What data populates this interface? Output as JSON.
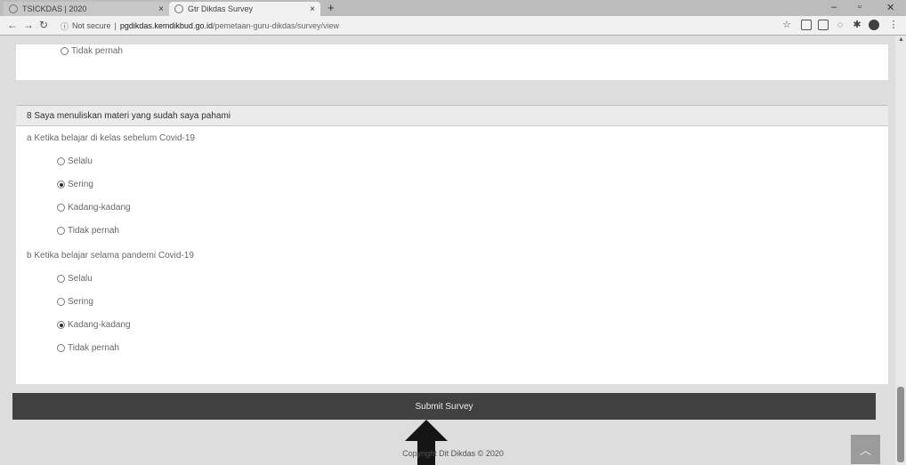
{
  "browser": {
    "tabs": [
      {
        "title": "TSICKDAS | 2020"
      },
      {
        "title": "Gtr Dikdas Survey"
      }
    ],
    "new_tab_label": "+",
    "close_label": "×",
    "url_security": "Not secure",
    "url_host": "pgdikdas.kemdikbud.go.id",
    "url_path": "/pemetaan-guru-dikdas/survey/view"
  },
  "prev_question": {
    "last_option": "Tidak pernah"
  },
  "question": {
    "title": "8 Saya menuliskan materi yang sudah saya pahami",
    "sub_questions": [
      {
        "label": "a Ketika belajar di kelas sebelum Covid-19",
        "options": [
          "Selalu",
          "Sering",
          "Kadang-kadang",
          "Tidak pernah"
        ],
        "selected": 1
      },
      {
        "label": "b Ketika belajar selama pandemi Covid-19",
        "options": [
          "Selalu",
          "Sering",
          "Kadang-kadang",
          "Tidak pernah"
        ],
        "selected": 2
      }
    ]
  },
  "submit_label": "Submit Survey",
  "footer_text": "Copyright Dit Dikdas © 2020",
  "icons": {
    "back": "arrow-left-icon",
    "forward": "arrow-right-icon",
    "reload": "reload-icon",
    "info": "info-icon",
    "star": "star-icon",
    "back_to_top": "chevron-up-icon",
    "annotation": "up-arrow-icon"
  }
}
